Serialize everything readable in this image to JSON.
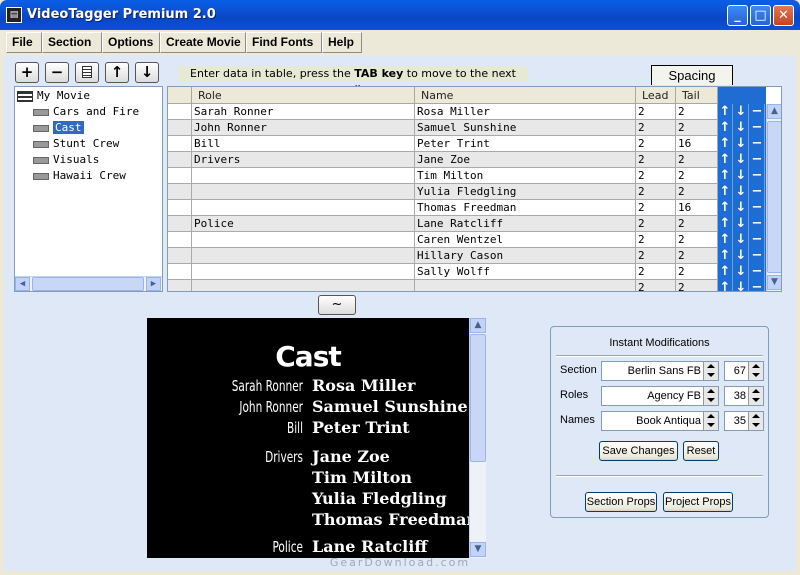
{
  "window": {
    "title": "VideoTagger Premium 2.0"
  },
  "menu": [
    "File",
    "Section",
    "Options",
    "Create Movie",
    "Find Fonts",
    "Help"
  ],
  "toolbar": {
    "add": "+",
    "remove": "−",
    "up": "↑",
    "down": "↓"
  },
  "hint": {
    "prefix": "Enter data in table, press the ",
    "key": "TAB key",
    "suffix": " to move to the next cell."
  },
  "tabs": {
    "spacing": "Spacing"
  },
  "tree": {
    "root": "My Movie",
    "items": [
      "Cars and Fire",
      "Cast",
      "Stunt Crew",
      "Visuals",
      "Hawaii Crew"
    ],
    "selected": "Cast"
  },
  "grid": {
    "columns": [
      "Role",
      "Name",
      "Lead",
      "Tail"
    ],
    "rows": [
      {
        "role": "Sarah Ronner",
        "name": "Rosa Miller",
        "lead": "2",
        "tail": "2"
      },
      {
        "role": "John Ronner",
        "name": "Samuel Sunshine",
        "lead": "2",
        "tail": "2"
      },
      {
        "role": "Bill",
        "name": "Peter Trint",
        "lead": "2",
        "tail": "16"
      },
      {
        "role": "Drivers",
        "name": "Jane Zoe",
        "lead": "2",
        "tail": "2"
      },
      {
        "role": "",
        "name": "Tim Milton",
        "lead": "2",
        "tail": "2"
      },
      {
        "role": "",
        "name": "Yulia Fledgling",
        "lead": "2",
        "tail": "2"
      },
      {
        "role": "",
        "name": "Thomas Freedman",
        "lead": "2",
        "tail": "16"
      },
      {
        "role": "Police",
        "name": "Lane Ratcliff",
        "lead": "2",
        "tail": "2"
      },
      {
        "role": "",
        "name": "Caren  Wentzel",
        "lead": "2",
        "tail": "2"
      },
      {
        "role": "",
        "name": "Hillary  Cason",
        "lead": "2",
        "tail": "2"
      },
      {
        "role": "",
        "name": "Sally  Wolff",
        "lead": "2",
        "tail": "2"
      },
      {
        "role": "",
        "name": "",
        "lead": "2",
        "tail": "2"
      }
    ],
    "row_buttons": {
      "up": "↑",
      "down": "↓",
      "remove": "−"
    }
  },
  "preview": {
    "toggle": "~",
    "title": "Cast",
    "lines": [
      {
        "role": "Sarah Ronner",
        "name": "Rosa Miller"
      },
      {
        "role": "John Ronner",
        "name": "Samuel Sunshine"
      },
      {
        "role": "Bill",
        "name": "Peter Trint"
      },
      {
        "role": "Drivers",
        "name": "Jane Zoe"
      },
      {
        "role": "",
        "name": "Tim Milton"
      },
      {
        "role": "",
        "name": "Yulia Fledgling"
      },
      {
        "role": "",
        "name": "Thomas Freedman"
      },
      {
        "role": "Police",
        "name": "Lane Ratcliff"
      }
    ]
  },
  "instant": {
    "title": "Instant Modifications",
    "section": {
      "label": "Section",
      "font": "Berlin Sans FB",
      "size": "67"
    },
    "roles": {
      "label": "Roles",
      "font": "Agency FB",
      "size": "38"
    },
    "names": {
      "label": "Names",
      "font": "Book Antiqua",
      "size": "35"
    },
    "save": "Save Changes",
    "reset": "Reset",
    "section_props": "Section Props",
    "project_props": "Project Props"
  },
  "watermark": "GearDownload.com"
}
